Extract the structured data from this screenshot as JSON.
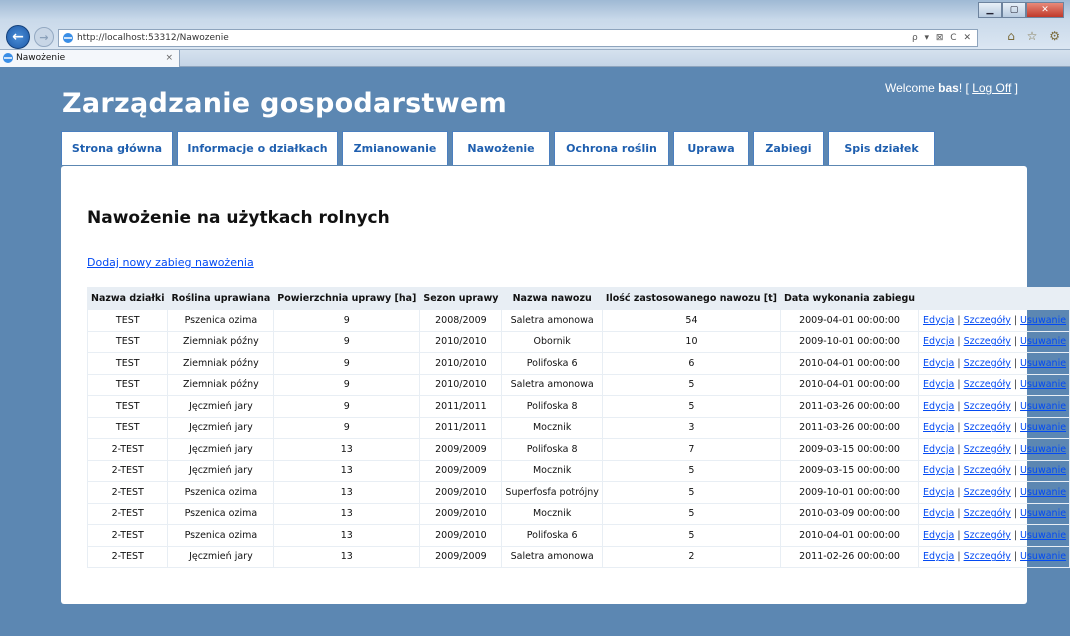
{
  "browser": {
    "url": "http://localhost:53312/Nawozenie",
    "tab_title": "Nawożenie",
    "tab_close": "×",
    "addr_tools": "ρ ▾ ⊠ C ✕",
    "right_icons": "⌂ ☆ ⚙"
  },
  "site": {
    "title": "Zarządzanie gospodarstwem",
    "welcome_prefix": "Welcome ",
    "user": "bas",
    "welcome_suffix": "! [ ",
    "logoff": "Log Off",
    "logoff_suffix": " ]"
  },
  "menu": [
    "Strona główna",
    "Informacje o działkach",
    "Zmianowanie",
    "Nawożenie",
    "Ochrona roślin",
    "Uprawa",
    "Zabiegi",
    "Spis działek"
  ],
  "page": {
    "heading": "Nawożenie na użytkach rolnych",
    "add_link": "Dodaj nowy zabieg nawożenia"
  },
  "table": {
    "headers": [
      "Nazwa działki",
      "Roślina uprawiana",
      "Powierzchnia uprawy [ha]",
      "Sezon uprawy",
      "Nazwa nawozu",
      "Ilość zastosowanego nawozu [t]",
      "Data wykonania zabiegu",
      ""
    ],
    "actions": {
      "edit": "Edycja",
      "details": "Szczegóły",
      "delete": "Usuwanie",
      "sep": "|"
    },
    "rows": [
      [
        "TEST",
        "Pszenica ozima",
        "9",
        "2008/2009",
        "Saletra amonowa",
        "54",
        "2009-04-01 00:00:00"
      ],
      [
        "TEST",
        "Ziemniak późny",
        "9",
        "2010/2010",
        "Obornik",
        "10",
        "2009-10-01 00:00:00"
      ],
      [
        "TEST",
        "Ziemniak późny",
        "9",
        "2010/2010",
        "Polifoska 6",
        "6",
        "2010-04-01 00:00:00"
      ],
      [
        "TEST",
        "Ziemniak późny",
        "9",
        "2010/2010",
        "Saletra amonowa",
        "5",
        "2010-04-01 00:00:00"
      ],
      [
        "TEST",
        "Jęczmień jary",
        "9",
        "2011/2011",
        "Polifoska 8",
        "5",
        "2011-03-26 00:00:00"
      ],
      [
        "TEST",
        "Jęczmień jary",
        "9",
        "2011/2011",
        "Mocznik",
        "3",
        "2011-03-26 00:00:00"
      ],
      [
        "2-TEST",
        "Jęczmień jary",
        "13",
        "2009/2009",
        "Polifoska 8",
        "7",
        "2009-03-15 00:00:00"
      ],
      [
        "2-TEST",
        "Jęczmień jary",
        "13",
        "2009/2009",
        "Mocznik",
        "5",
        "2009-03-15 00:00:00"
      ],
      [
        "2-TEST",
        "Pszenica ozima",
        "13",
        "2009/2010",
        "Superfosfa potrójny",
        "5",
        "2009-10-01 00:00:00"
      ],
      [
        "2-TEST",
        "Pszenica ozima",
        "13",
        "2009/2010",
        "Mocznik",
        "5",
        "2010-03-09 00:00:00"
      ],
      [
        "2-TEST",
        "Pszenica ozima",
        "13",
        "2009/2010",
        "Polifoska 6",
        "5",
        "2010-04-01 00:00:00"
      ],
      [
        "2-TEST",
        "Jęczmień jary",
        "13",
        "2009/2009",
        "Saletra amonowa",
        "2",
        "2011-02-26 00:00:00"
      ]
    ]
  },
  "colors": {
    "page_bg": "#5c87b2",
    "link": "#034af3",
    "header_bg": "#e8eef4"
  }
}
